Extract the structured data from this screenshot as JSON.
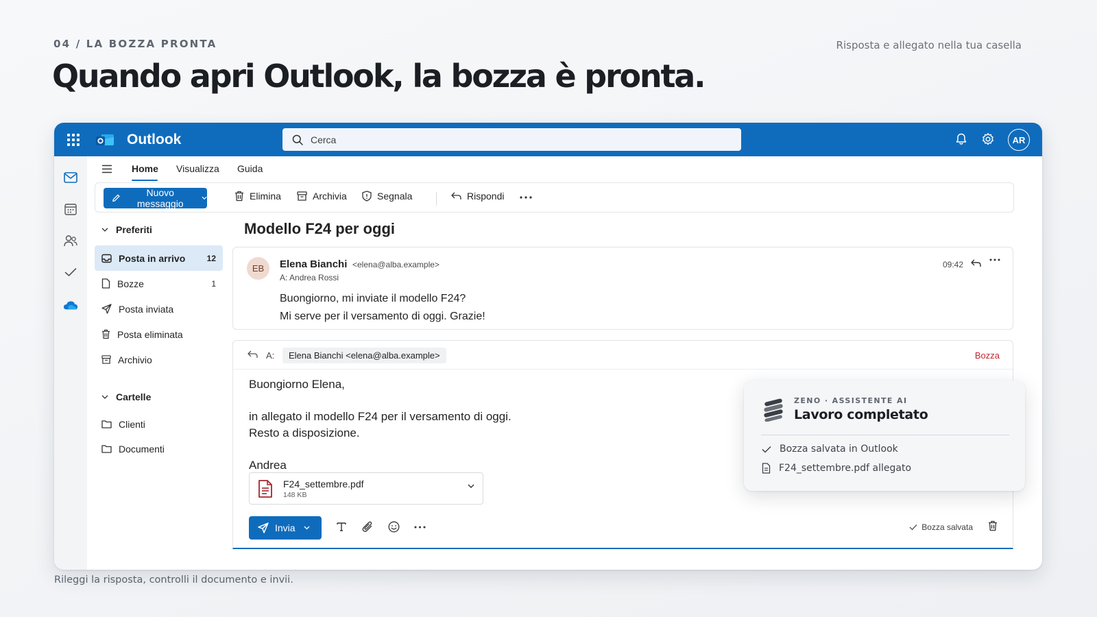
{
  "slide": {
    "kicker": "04 / LA BOZZA PRONTA",
    "title": "Quando apri Outlook, la bozza è pronta.",
    "subtitle": "Risposta e allegato nella tua casella",
    "caption": "Rileggi la risposta, controlli il documento e invii."
  },
  "topbar": {
    "app_name": "Outlook",
    "search_placeholder": "Cerca",
    "user_initials": "AR",
    "icons": [
      "app-launcher-icon",
      "outlook-logo-icon",
      "search-icon",
      "bell-icon",
      "gear-icon"
    ],
    "accent_color": "#0f6cbd"
  },
  "rail": {
    "icons": [
      "mail-icon",
      "calendar-icon",
      "people-icon",
      "todo-check-icon",
      "onedrive-cloud-icon"
    ]
  },
  "ribbon": {
    "tabs": [
      {
        "label": "Home",
        "active": true
      },
      {
        "label": "Visualizza",
        "active": false
      },
      {
        "label": "Guida",
        "active": false
      }
    ]
  },
  "toolbar": {
    "new_message": "Nuovo messaggio",
    "delete": "Elimina",
    "archive": "Archivia",
    "report": "Segnala",
    "reply": "Rispondi"
  },
  "folders": {
    "favorites_header": "Preferiti",
    "items": [
      {
        "label": "Posta in arrivo",
        "count": "12",
        "icon": "inbox-icon",
        "selected": true
      },
      {
        "label": "Bozze",
        "count": "1",
        "icon": "draft-icon",
        "selected": false
      },
      {
        "label": "Posta inviata",
        "count": "",
        "icon": "send-icon",
        "selected": false
      },
      {
        "label": "Posta eliminata",
        "count": "",
        "icon": "trash-icon",
        "selected": false
      },
      {
        "label": "Archivio",
        "count": "",
        "icon": "archive-icon",
        "selected": false
      }
    ],
    "folders_header": "Cartelle",
    "custom": [
      {
        "label": "Clienti",
        "icon": "folder-icon"
      },
      {
        "label": "Documenti",
        "icon": "folder-icon"
      }
    ]
  },
  "message": {
    "subject": "Modello F24 per oggi",
    "sender_initials": "EB",
    "sender_name": "Elena Bianchi",
    "sender_email": "<elena@alba.example>",
    "recipient": "A: Andrea Rossi",
    "time": "09:42",
    "body": [
      "Buongiorno, mi inviate il modello F24?",
      "Mi serve per il versamento di oggi. Grazie!"
    ]
  },
  "compose": {
    "to_label": "A:",
    "to_chip": "Elena Bianchi <elena@alba.example>",
    "status": "Bozza",
    "status_color": "#c4262e",
    "body": [
      "Buongiorno Elena,",
      "",
      "in allegato il modello F24 per il versamento di oggi.",
      "Resto a disposizione.",
      "",
      "Andrea"
    ],
    "attachment": {
      "name": "F24_settembre.pdf",
      "size": "148 KB",
      "icon": "pdf-file-icon"
    },
    "send_label": "Invia",
    "saved_label": "Bozza salvata"
  },
  "ai_card": {
    "kicker": "ZENO · ASSISTENTE AI",
    "title": "Lavoro completato",
    "items": [
      {
        "icon": "check-icon",
        "label": "Bozza salvata in Outlook"
      },
      {
        "icon": "document-icon",
        "label": "F24_settembre.pdf allegato"
      }
    ]
  }
}
